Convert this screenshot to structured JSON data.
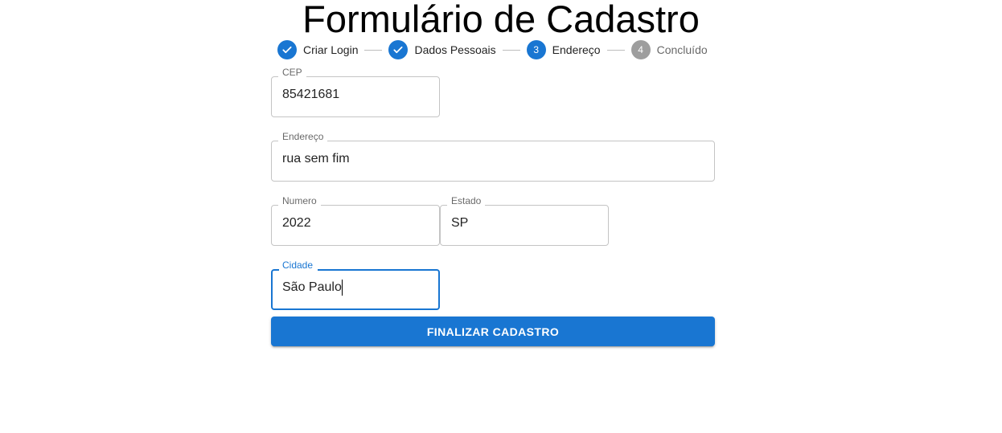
{
  "page": {
    "title": "Formulário de Cadastro"
  },
  "stepper": {
    "steps": [
      {
        "label": "Criar Login",
        "state": "completed",
        "icon": "check-icon"
      },
      {
        "label": "Dados Pessoais",
        "state": "completed",
        "icon": "check-icon"
      },
      {
        "label": "Endereço",
        "state": "active",
        "number": "3"
      },
      {
        "label": "Concluído",
        "state": "pending",
        "number": "4"
      }
    ]
  },
  "form": {
    "cep": {
      "label": "CEP",
      "value": "85421681"
    },
    "endereco": {
      "label": "Endereço",
      "value": "rua sem fim"
    },
    "numero": {
      "label": "Numero",
      "value": "2022"
    },
    "estado": {
      "label": "Estado",
      "value": "SP"
    },
    "cidade": {
      "label": "Cidade",
      "value": "São Paulo"
    },
    "submit_label": "Finalizar Cadastro"
  },
  "colors": {
    "primary": "#1976d2",
    "pending_step": "#9e9e9e"
  }
}
